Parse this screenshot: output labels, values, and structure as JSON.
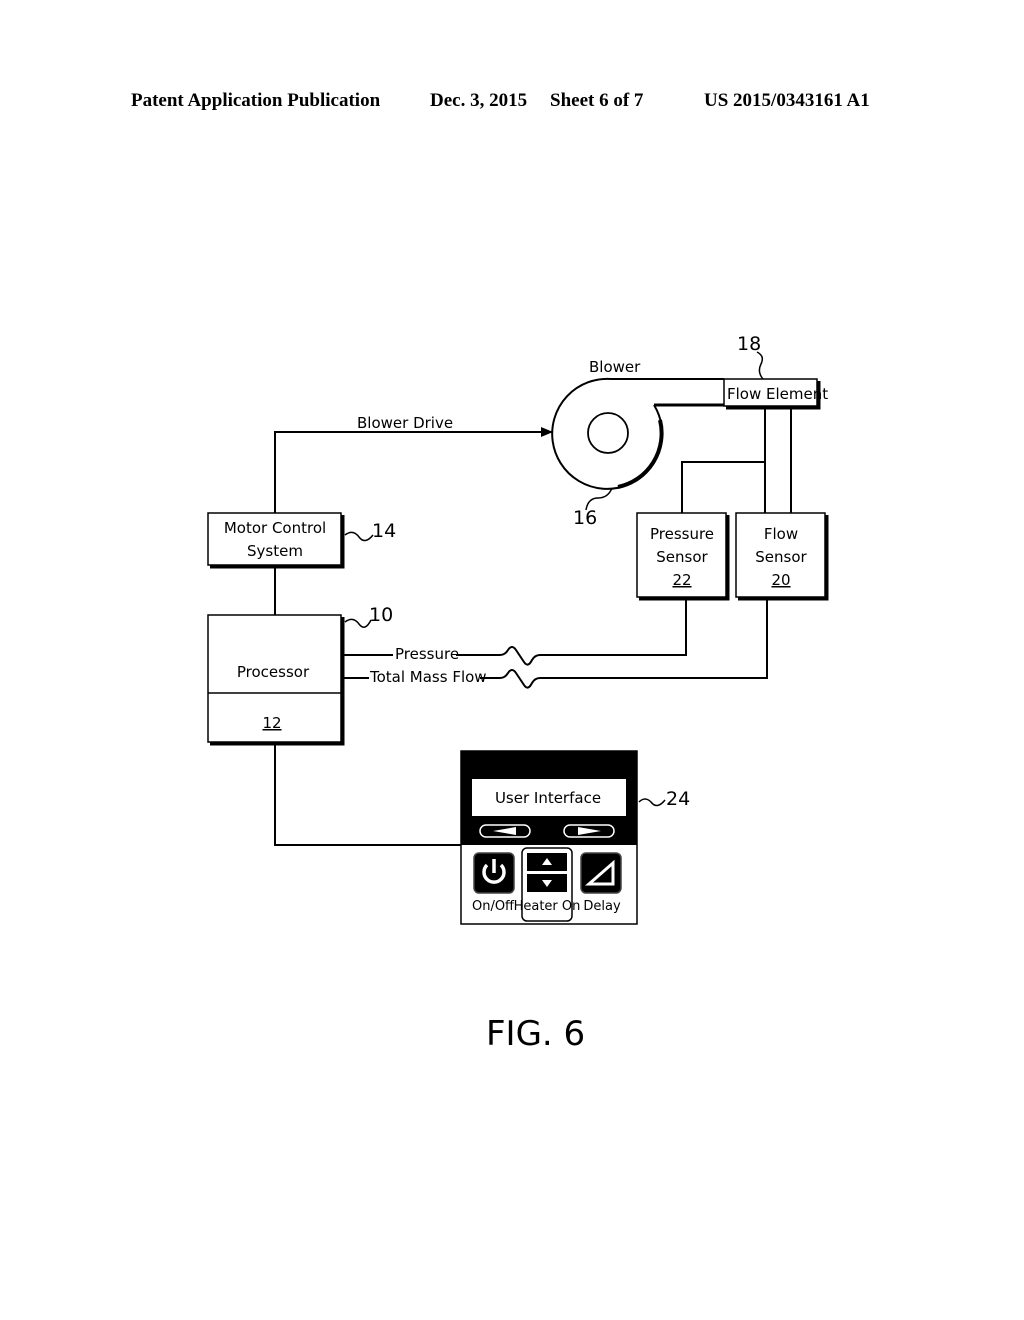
{
  "header": {
    "publication": "Patent Application Publication",
    "date": "Dec. 3, 2015",
    "sheet": "Sheet 6 of 7",
    "number": "US 2015/0343161 A1"
  },
  "figure": {
    "label": "FIG. 6",
    "blower": {
      "label": "Blower",
      "ref": "16"
    },
    "flow_element": {
      "label": "Flow Element",
      "ref": "18"
    },
    "blower_drive": {
      "label": "Blower Drive"
    },
    "motor_control": {
      "line1": "Motor Control",
      "line2": "System",
      "ref": "14"
    },
    "pressure_sensor": {
      "line1": "Pressure",
      "line2": "Sensor",
      "ref": "22"
    },
    "flow_sensor": {
      "line1": "Flow",
      "line2": "Sensor",
      "ref": "20"
    },
    "processor": {
      "label": "Processor",
      "ref": "12",
      "callout": "10"
    },
    "signals": {
      "pressure": "Pressure",
      "total_mass_flow": "Total Mass Flow"
    },
    "user_interface": {
      "label": "User Interface",
      "ref": "24",
      "buttons": {
        "on_off": "On/Off",
        "heater_on": "Heater On",
        "delay": "Delay"
      }
    }
  }
}
